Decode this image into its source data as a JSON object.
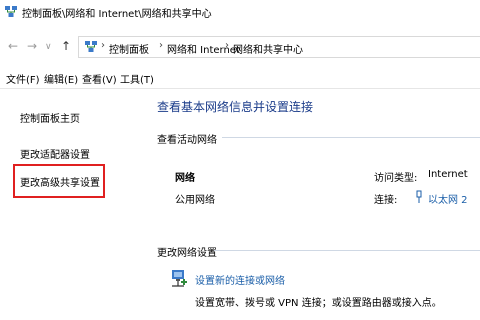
{
  "window": {
    "title": "控制面板\\网络和 Internet\\网络和共享中心"
  },
  "nav": {
    "back": "←",
    "forward": "→",
    "dropdown": "∨",
    "up": "↑"
  },
  "address": {
    "separator": "›",
    "crumbs": [
      "控制面板",
      "网络和 Internet",
      "网络和共享中心"
    ]
  },
  "menu": {
    "items": [
      "文件(F)",
      "编辑(E)",
      "查看(V)",
      "工具(T)"
    ]
  },
  "sidebar": {
    "items": [
      {
        "label": "控制面板主页"
      },
      {
        "label": "更改适配器设置"
      },
      {
        "label": "更改高级共享设置"
      }
    ]
  },
  "main": {
    "title": "查看基本网络信息并设置连接",
    "active_networks_label": "查看活动网络",
    "network": {
      "name": "网络",
      "type": "公用网络",
      "access_type_label": "访问类型:",
      "access_type_value": "Internet",
      "connection_label": "连接:",
      "connection_value": "以太网 2"
    },
    "change_settings_label": "更改网络设置",
    "setup": {
      "link": "设置新的连接或网络",
      "description": "设置宽带、拨号或 VPN 连接；或设置路由器或接入点。"
    }
  },
  "colors": {
    "link": "#1a5ea8",
    "title": "#1b3c8a",
    "highlight": "#e02020"
  }
}
